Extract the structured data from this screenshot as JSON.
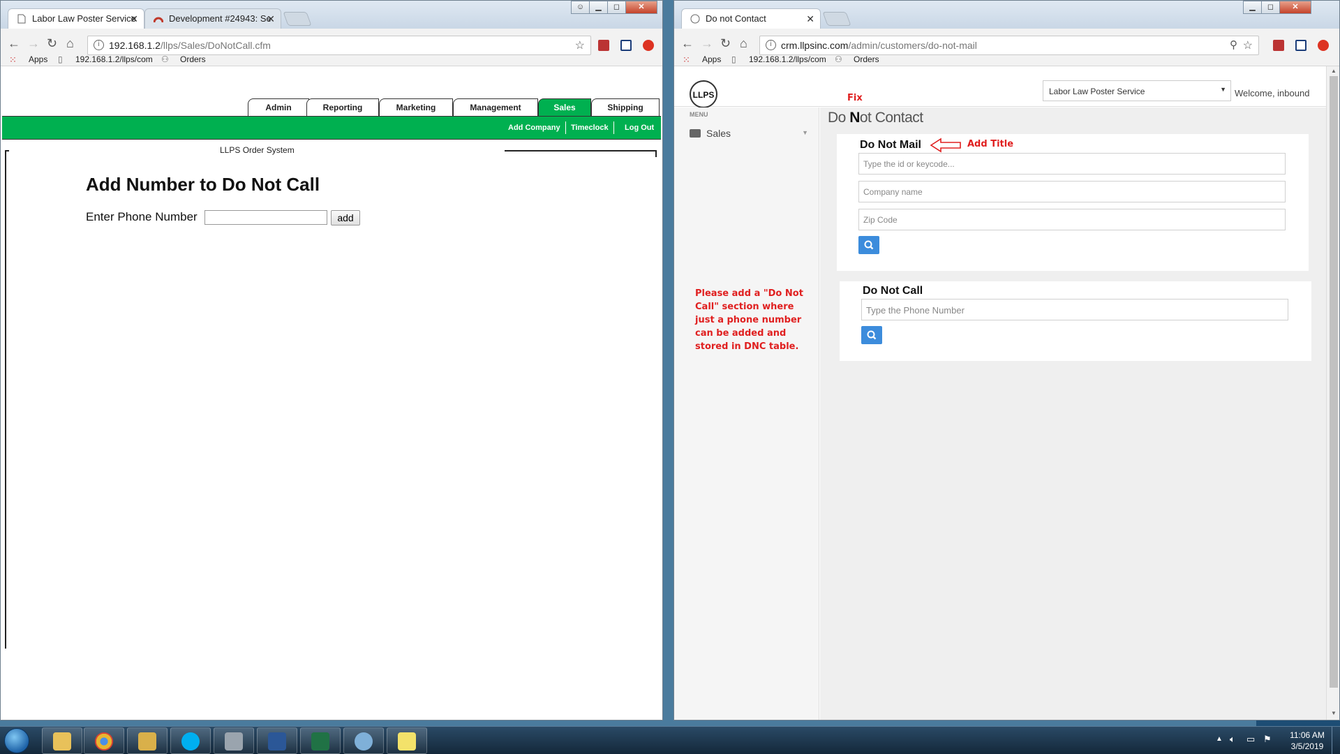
{
  "left_window": {
    "tabs": [
      {
        "title": "Labor Law Poster Service",
        "active": true
      },
      {
        "title": "Development #24943: Se",
        "active": false
      }
    ],
    "url_host": "192.168.1.2",
    "url_path": "/llps/Sales/DoNotCall.cfm",
    "bookmarks": [
      "Apps",
      "192.168.1.2/llps/com",
      "Orders"
    ],
    "menu_tabs": [
      "Admin",
      "Reporting",
      "Marketing",
      "Management",
      "Sales",
      "Shipping"
    ],
    "active_menu": "Sales",
    "sub_links": [
      "Add Company",
      "Timeclock",
      "Log Out"
    ],
    "system_title": "LLPS Order System",
    "heading": "Add Number to Do Not Call",
    "phone_label": "Enter Phone Number",
    "phone_value": "",
    "add_button": "add"
  },
  "right_window": {
    "tabs": [
      {
        "title": "Do not Contact",
        "active": true
      }
    ],
    "url_host": "crm.llpsinc.com",
    "url_path": "/admin/customers/do-not-mail",
    "bookmarks": [
      "Apps",
      "192.168.1.2/llps/com",
      "Orders"
    ],
    "logo_text": "LLPS",
    "company_select": "Labor Law Poster Service",
    "welcome": "Welcome, inbound",
    "menu_label": "MENU",
    "sidebar_item": "Sales",
    "page_title_pre": "Do ",
    "page_title_n": "N",
    "page_title_post": "ot Contact",
    "dnm_title": "Do Not Mail",
    "dnm_fields": [
      {
        "placeholder": "Type the id or keycode..."
      },
      {
        "placeholder": "Company name"
      },
      {
        "placeholder": "Zip Code"
      }
    ],
    "dnc_title": "Do Not Call",
    "dnc_placeholder": "Type the Phone Number"
  },
  "annotations": {
    "fix": "Fix",
    "add_title": "Add Title",
    "note": "Please add a \"Do Not Call\" section where just a phone number can be added and stored in DNC table."
  },
  "clock": {
    "time": "11:06 AM",
    "date": "3/5/2019"
  },
  "colors": {
    "llps_green": "#00b050",
    "crm_blue": "#3c8cdc",
    "annotation_red": "#e02020"
  }
}
